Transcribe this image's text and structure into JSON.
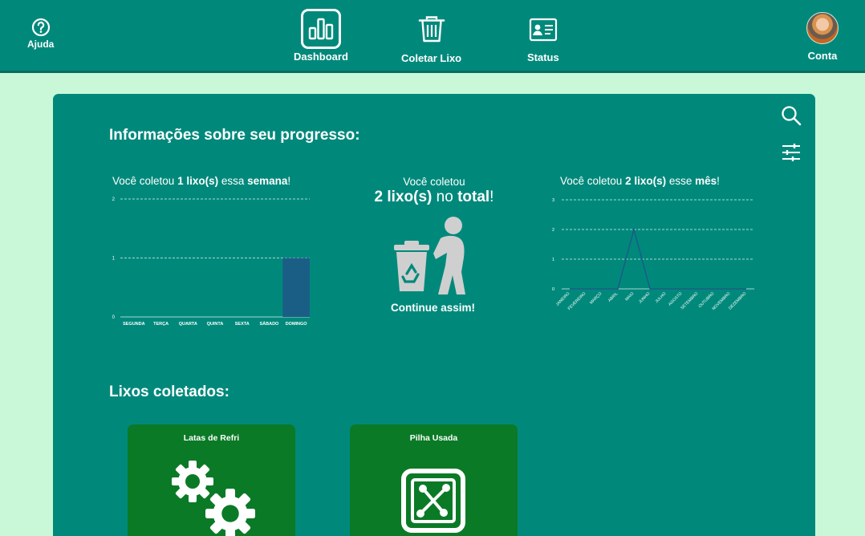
{
  "nav": {
    "help": {
      "label": "Ajuda",
      "icon": "help-circle-icon"
    },
    "dashboard": {
      "label": "Dashboard",
      "icon": "bar-chart-icon"
    },
    "collect": {
      "label": "Coletar Lixo",
      "icon": "trash-can-icon"
    },
    "status": {
      "label": "Status",
      "icon": "id-card-icon"
    },
    "account": {
      "label": "Conta",
      "icon": "avatar"
    }
  },
  "progress": {
    "heading": "Informações sobre seu progresso:",
    "week": {
      "prefix": "Você coletou ",
      "count": "1 lixo(s)",
      "middle": " essa ",
      "period": "semana",
      "suffix": "!"
    },
    "total": {
      "line1": "Você coletou",
      "count": "2 lixo(s)",
      "middle": " no ",
      "word": "total",
      "suffix": "!",
      "footer": "Continue assim!"
    },
    "month": {
      "prefix": "Você coletou ",
      "count": "2 lixo(s)",
      "middle": " esse ",
      "period": "mês",
      "suffix": "!"
    }
  },
  "tools": {
    "search_icon": "search-icon",
    "filter_icon": "sliders-icon"
  },
  "chart_data": [
    {
      "type": "bar",
      "categories": [
        "SEGUNDA",
        "TERÇA",
        "QUARTA",
        "QUINTA",
        "SEXTA",
        "SÁBADO",
        "DOMINGO"
      ],
      "values": [
        0,
        0,
        0,
        0,
        0,
        0,
        1
      ],
      "ylim": [
        0,
        2
      ],
      "yticks": [
        0,
        1,
        2
      ],
      "grid": true,
      "bar_color": "#1a5e86"
    },
    {
      "type": "line",
      "categories": [
        "JANEIRO",
        "FEVEREIRO",
        "MARÇO",
        "ABRIL",
        "MAIO",
        "JUNHO",
        "JULHO",
        "AGOSTO",
        "SETEMBRO",
        "OUTUBRO",
        "NOVEMBRO",
        "DEZEMBRO"
      ],
      "values": [
        0,
        0,
        0,
        0,
        2,
        0,
        0,
        0,
        0,
        0,
        0,
        0
      ],
      "ylim": [
        0,
        3
      ],
      "yticks": [
        0,
        1,
        2,
        3
      ],
      "grid": true,
      "line_color": "#1a5e86"
    }
  ],
  "collected": {
    "heading": "Lixos coletados:",
    "items": [
      {
        "title": "Latas de Refri",
        "icon": "gears-icon"
      },
      {
        "title": "Pilha Usada",
        "icon": "circuit-chip-icon"
      }
    ]
  },
  "colors": {
    "background": "#c8f8d8",
    "primary": "#00897b",
    "card": "#0b7a26",
    "bar": "#1a5e86"
  }
}
